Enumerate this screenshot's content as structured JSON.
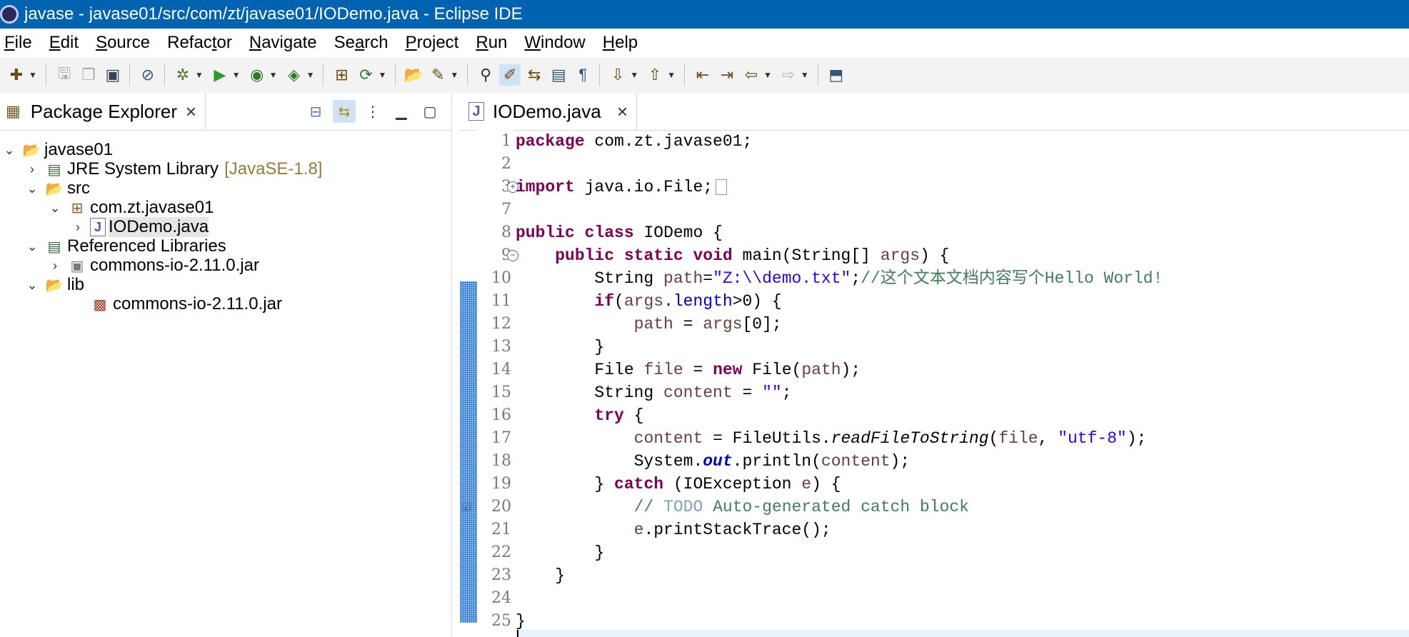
{
  "window": {
    "title": "javase - javase01/src/com/zt/javase01/IODemo.java - Eclipse IDE"
  },
  "menu": [
    {
      "label": "File",
      "mn": "F",
      "rest": "ile"
    },
    {
      "label": "Edit",
      "mn": "E",
      "rest": "dit"
    },
    {
      "label": "Source",
      "mn": "S",
      "rest": "ource"
    },
    {
      "label": "Refactor",
      "pre": "Refac",
      "mn": "t",
      "rest": "or"
    },
    {
      "label": "Navigate",
      "mn": "N",
      "rest": "avigate"
    },
    {
      "label": "Search",
      "pre": "Se",
      "mn": "a",
      "rest": "rch"
    },
    {
      "label": "Project",
      "mn": "P",
      "rest": "roject"
    },
    {
      "label": "Run",
      "mn": "R",
      "rest": "un"
    },
    {
      "label": "Window",
      "mn": "W",
      "rest": "indow"
    },
    {
      "label": "Help",
      "mn": "H",
      "rest": "elp"
    }
  ],
  "package_explorer": {
    "tab_label": "Package Explorer",
    "tree": [
      {
        "label": "javase01",
        "decor": "",
        "icon": "project-icon",
        "twisty": "⌄"
      },
      {
        "label": "JRE System Library",
        "decor": "[JavaSE-1.8]",
        "icon": "library-icon",
        "twisty": "›"
      },
      {
        "label": "src",
        "decor": "",
        "icon": "source-folder-icon",
        "twisty": "⌄"
      },
      {
        "label": "com.zt.javase01",
        "decor": "",
        "icon": "package-icon",
        "twisty": "⌄"
      },
      {
        "label": "IODemo.java",
        "decor": "",
        "icon": "java-file-icon",
        "twisty": "›"
      },
      {
        "label": "Referenced Libraries",
        "decor": "",
        "icon": "library-icon",
        "twisty": "⌄"
      },
      {
        "label": "commons-io-2.11.0.jar",
        "decor": "",
        "icon": "jar-icon",
        "twisty": "›"
      },
      {
        "label": "lib",
        "decor": "",
        "icon": "folder-icon",
        "twisty": "⌄"
      },
      {
        "label": "commons-io-2.11.0.jar",
        "decor": "",
        "icon": "jar-file-icon",
        "twisty": ""
      }
    ]
  },
  "editor": {
    "tab_label": "IODemo.java",
    "tab_icon_letter": "J",
    "lines": [
      {
        "n": "1",
        "tokens": [
          [
            "kw",
            "package"
          ],
          [
            "",
            " com.zt.javase01;"
          ]
        ]
      },
      {
        "n": "2",
        "tokens": []
      },
      {
        "n": "3",
        "tokens": [
          [
            "kw",
            "import"
          ],
          [
            "",
            " java.io.File;"
          ]
        ]
      },
      {
        "n": "7",
        "tokens": []
      },
      {
        "n": "8",
        "tokens": [
          [
            "kw",
            "public"
          ],
          [
            "",
            " "
          ],
          [
            "kw",
            "class"
          ],
          [
            "",
            " IODemo {"
          ]
        ]
      },
      {
        "n": "9",
        "tokens": [
          [
            "",
            "    "
          ],
          [
            "kw",
            "public"
          ],
          [
            "",
            " "
          ],
          [
            "kw",
            "static"
          ],
          [
            "",
            " "
          ],
          [
            "kw",
            "void"
          ],
          [
            "",
            " main(String[] "
          ],
          [
            "var",
            "args"
          ],
          [
            "",
            ") {"
          ]
        ]
      },
      {
        "n": "10",
        "tokens": [
          [
            "",
            "        String "
          ],
          [
            "var",
            "path"
          ],
          [
            "",
            "="
          ],
          [
            "str",
            "\"Z:\\\\demo.txt\""
          ],
          [
            "",
            ";"
          ],
          [
            "cm",
            "//这个文本文档内容写个Hello World!"
          ]
        ]
      },
      {
        "n": "11",
        "tokens": [
          [
            "",
            "        "
          ],
          [
            "kw",
            "if"
          ],
          [
            "",
            "("
          ],
          [
            "var",
            "args"
          ],
          [
            "",
            "."
          ],
          [
            "fld",
            "length"
          ],
          [
            "",
            ">0) {"
          ]
        ]
      },
      {
        "n": "12",
        "tokens": [
          [
            "",
            "            "
          ],
          [
            "var",
            "path"
          ],
          [
            "",
            " = "
          ],
          [
            "var",
            "args"
          ],
          [
            "",
            "[0];"
          ]
        ]
      },
      {
        "n": "13",
        "tokens": [
          [
            "",
            "        }"
          ]
        ]
      },
      {
        "n": "14",
        "tokens": [
          [
            "",
            "        File "
          ],
          [
            "var",
            "file"
          ],
          [
            "",
            " = "
          ],
          [
            "kw",
            "new"
          ],
          [
            "",
            " File("
          ],
          [
            "var",
            "path"
          ],
          [
            "",
            ");"
          ]
        ]
      },
      {
        "n": "15",
        "tokens": [
          [
            "",
            "        String "
          ],
          [
            "var",
            "content"
          ],
          [
            "",
            " = "
          ],
          [
            "str",
            "\"\""
          ],
          [
            "",
            ";"
          ]
        ]
      },
      {
        "n": "16",
        "tokens": [
          [
            "",
            "        "
          ],
          [
            "kw",
            "try"
          ],
          [
            "",
            " {"
          ]
        ]
      },
      {
        "n": "17",
        "tokens": [
          [
            "",
            "            "
          ],
          [
            "var",
            "content"
          ],
          [
            "",
            " = FileUtils."
          ],
          [
            "smeth",
            "readFileToString"
          ],
          [
            "",
            "("
          ],
          [
            "var",
            "file"
          ],
          [
            "",
            ", "
          ],
          [
            "str",
            "\"utf-8\""
          ],
          [
            "",
            ");"
          ]
        ]
      },
      {
        "n": "18",
        "tokens": [
          [
            "",
            "            System."
          ],
          [
            "sfld",
            "out"
          ],
          [
            "",
            ".println("
          ],
          [
            "var",
            "content"
          ],
          [
            "",
            ");"
          ]
        ]
      },
      {
        "n": "19",
        "tokens": [
          [
            "",
            "        } "
          ],
          [
            "kw",
            "catch"
          ],
          [
            "",
            " (IOException "
          ],
          [
            "var",
            "e"
          ],
          [
            "",
            ") {"
          ]
        ]
      },
      {
        "n": "20",
        "tokens": [
          [
            "",
            "            "
          ],
          [
            "cm",
            "// "
          ],
          [
            "todo",
            "TODO"
          ],
          [
            "cm",
            " Auto-generated catch block"
          ]
        ]
      },
      {
        "n": "21",
        "tokens": [
          [
            "",
            "            "
          ],
          [
            "var",
            "e"
          ],
          [
            "",
            ".printStackTrace();"
          ]
        ]
      },
      {
        "n": "22",
        "tokens": [
          [
            "",
            "        }"
          ]
        ]
      },
      {
        "n": "23",
        "tokens": [
          [
            "",
            "    }"
          ]
        ]
      },
      {
        "n": "24",
        "tokens": []
      },
      {
        "n": "25",
        "tokens": [
          [
            "",
            "}"
          ]
        ]
      }
    ]
  }
}
